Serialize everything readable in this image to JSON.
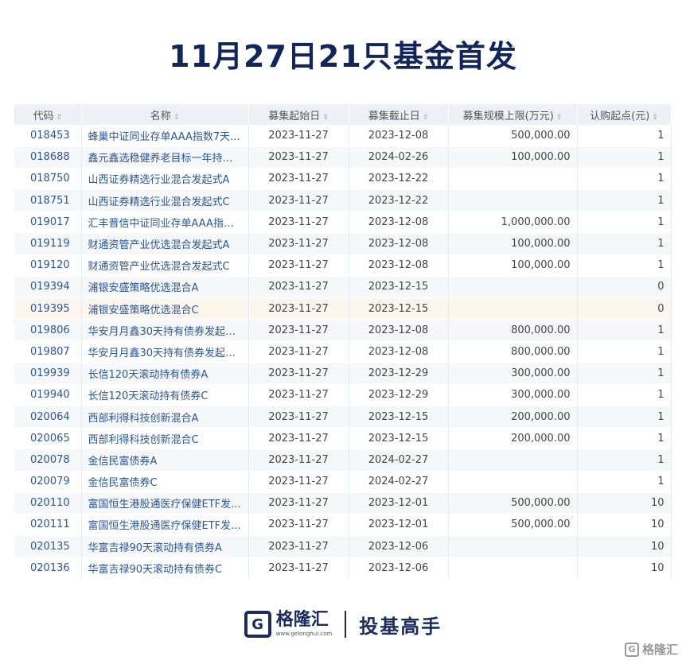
{
  "title": "11月27日21只基金首发",
  "table": {
    "headers": [
      "代码",
      "名称",
      "募集起始日",
      "募集截止日",
      "募集规模上限(万元)",
      "认购起点(元)"
    ],
    "sort_icon": "⇕",
    "rows": [
      {
        "code": "018453",
        "name": "蜂巢中证同业存单AAA指数7天...",
        "start": "2023-11-27",
        "end": "2023-12-08",
        "cap": "500,000.00",
        "min": "1"
      },
      {
        "code": "018688",
        "name": "鑫元鑫选稳健养老目标一年持有...",
        "start": "2023-11-27",
        "end": "2024-02-26",
        "cap": "100,000.00",
        "min": "1"
      },
      {
        "code": "018750",
        "name": "山西证券精选行业混合发起式A",
        "start": "2023-11-27",
        "end": "2023-12-22",
        "cap": "",
        "min": "1"
      },
      {
        "code": "018751",
        "name": "山西证券精选行业混合发起式C",
        "start": "2023-11-27",
        "end": "2023-12-22",
        "cap": "",
        "min": "1"
      },
      {
        "code": "019017",
        "name": "汇丰晋信中证同业存单AAA指数...",
        "start": "2023-11-27",
        "end": "2023-12-08",
        "cap": "1,000,000.00",
        "min": "1"
      },
      {
        "code": "019119",
        "name": "财通资管产业优选混合发起式A",
        "start": "2023-11-27",
        "end": "2023-12-08",
        "cap": "100,000.00",
        "min": "1"
      },
      {
        "code": "019120",
        "name": "财通资管产业优选混合发起式C",
        "start": "2023-11-27",
        "end": "2023-12-08",
        "cap": "100,000.00",
        "min": "1"
      },
      {
        "code": "019394",
        "name": "浦银安盛策略优选混合A",
        "start": "2023-11-27",
        "end": "2023-12-15",
        "cap": "",
        "min": "0"
      },
      {
        "code": "019395",
        "name": "浦银安盛策略优选混合C",
        "start": "2023-11-27",
        "end": "2023-12-15",
        "cap": "",
        "min": "0"
      },
      {
        "code": "019806",
        "name": "华安月月鑫30天持有债券发起式A",
        "start": "2023-11-27",
        "end": "2023-12-08",
        "cap": "800,000.00",
        "min": "1"
      },
      {
        "code": "019807",
        "name": "华安月月鑫30天持有债券发起式C",
        "start": "2023-11-27",
        "end": "2023-12-08",
        "cap": "800,000.00",
        "min": "1"
      },
      {
        "code": "019939",
        "name": "长信120天滚动持有债券A",
        "start": "2023-11-27",
        "end": "2023-12-29",
        "cap": "300,000.00",
        "min": "1"
      },
      {
        "code": "019940",
        "name": "长信120天滚动持有债券C",
        "start": "2023-11-27",
        "end": "2023-12-29",
        "cap": "300,000.00",
        "min": "1"
      },
      {
        "code": "020064",
        "name": "西部利得科技创新混合A",
        "start": "2023-11-27",
        "end": "2023-12-15",
        "cap": "200,000.00",
        "min": "1"
      },
      {
        "code": "020065",
        "name": "西部利得科技创新混合C",
        "start": "2023-11-27",
        "end": "2023-12-15",
        "cap": "200,000.00",
        "min": "1"
      },
      {
        "code": "020078",
        "name": "金信民富债券A",
        "start": "2023-11-27",
        "end": "2024-02-27",
        "cap": "",
        "min": "1"
      },
      {
        "code": "020079",
        "name": "金信民富债券C",
        "start": "2023-11-27",
        "end": "2024-02-27",
        "cap": "",
        "min": "1"
      },
      {
        "code": "020110",
        "name": "富国恒生港股通医疗保健ETF发...",
        "start": "2023-11-27",
        "end": "2023-12-01",
        "cap": "500,000.00",
        "min": "10"
      },
      {
        "code": "020111",
        "name": "富国恒生港股通医疗保健ETF发...",
        "start": "2023-11-27",
        "end": "2023-12-01",
        "cap": "500,000.00",
        "min": "10"
      },
      {
        "code": "020135",
        "name": "华富吉禄90天滚动持有债券A",
        "start": "2023-11-27",
        "end": "2023-12-06",
        "cap": "",
        "min": "10"
      },
      {
        "code": "020136",
        "name": "华富吉禄90天滚动持有债券C",
        "start": "2023-11-27",
        "end": "2023-12-06",
        "cap": "",
        "min": "10"
      }
    ]
  },
  "footer": {
    "logo_mark": "G",
    "logo_name": "格隆汇",
    "logo_url": "www.gelonghui.com",
    "slogan": "投基高手"
  },
  "watermark": {
    "mark": "G",
    "text": "格隆汇"
  },
  "colors": {
    "title": "#13265a",
    "link": "#2a5599",
    "header_bg": "#edf0f5",
    "row_alt": "#f6f7f9",
    "row_highlight": "#fdf6ef"
  }
}
